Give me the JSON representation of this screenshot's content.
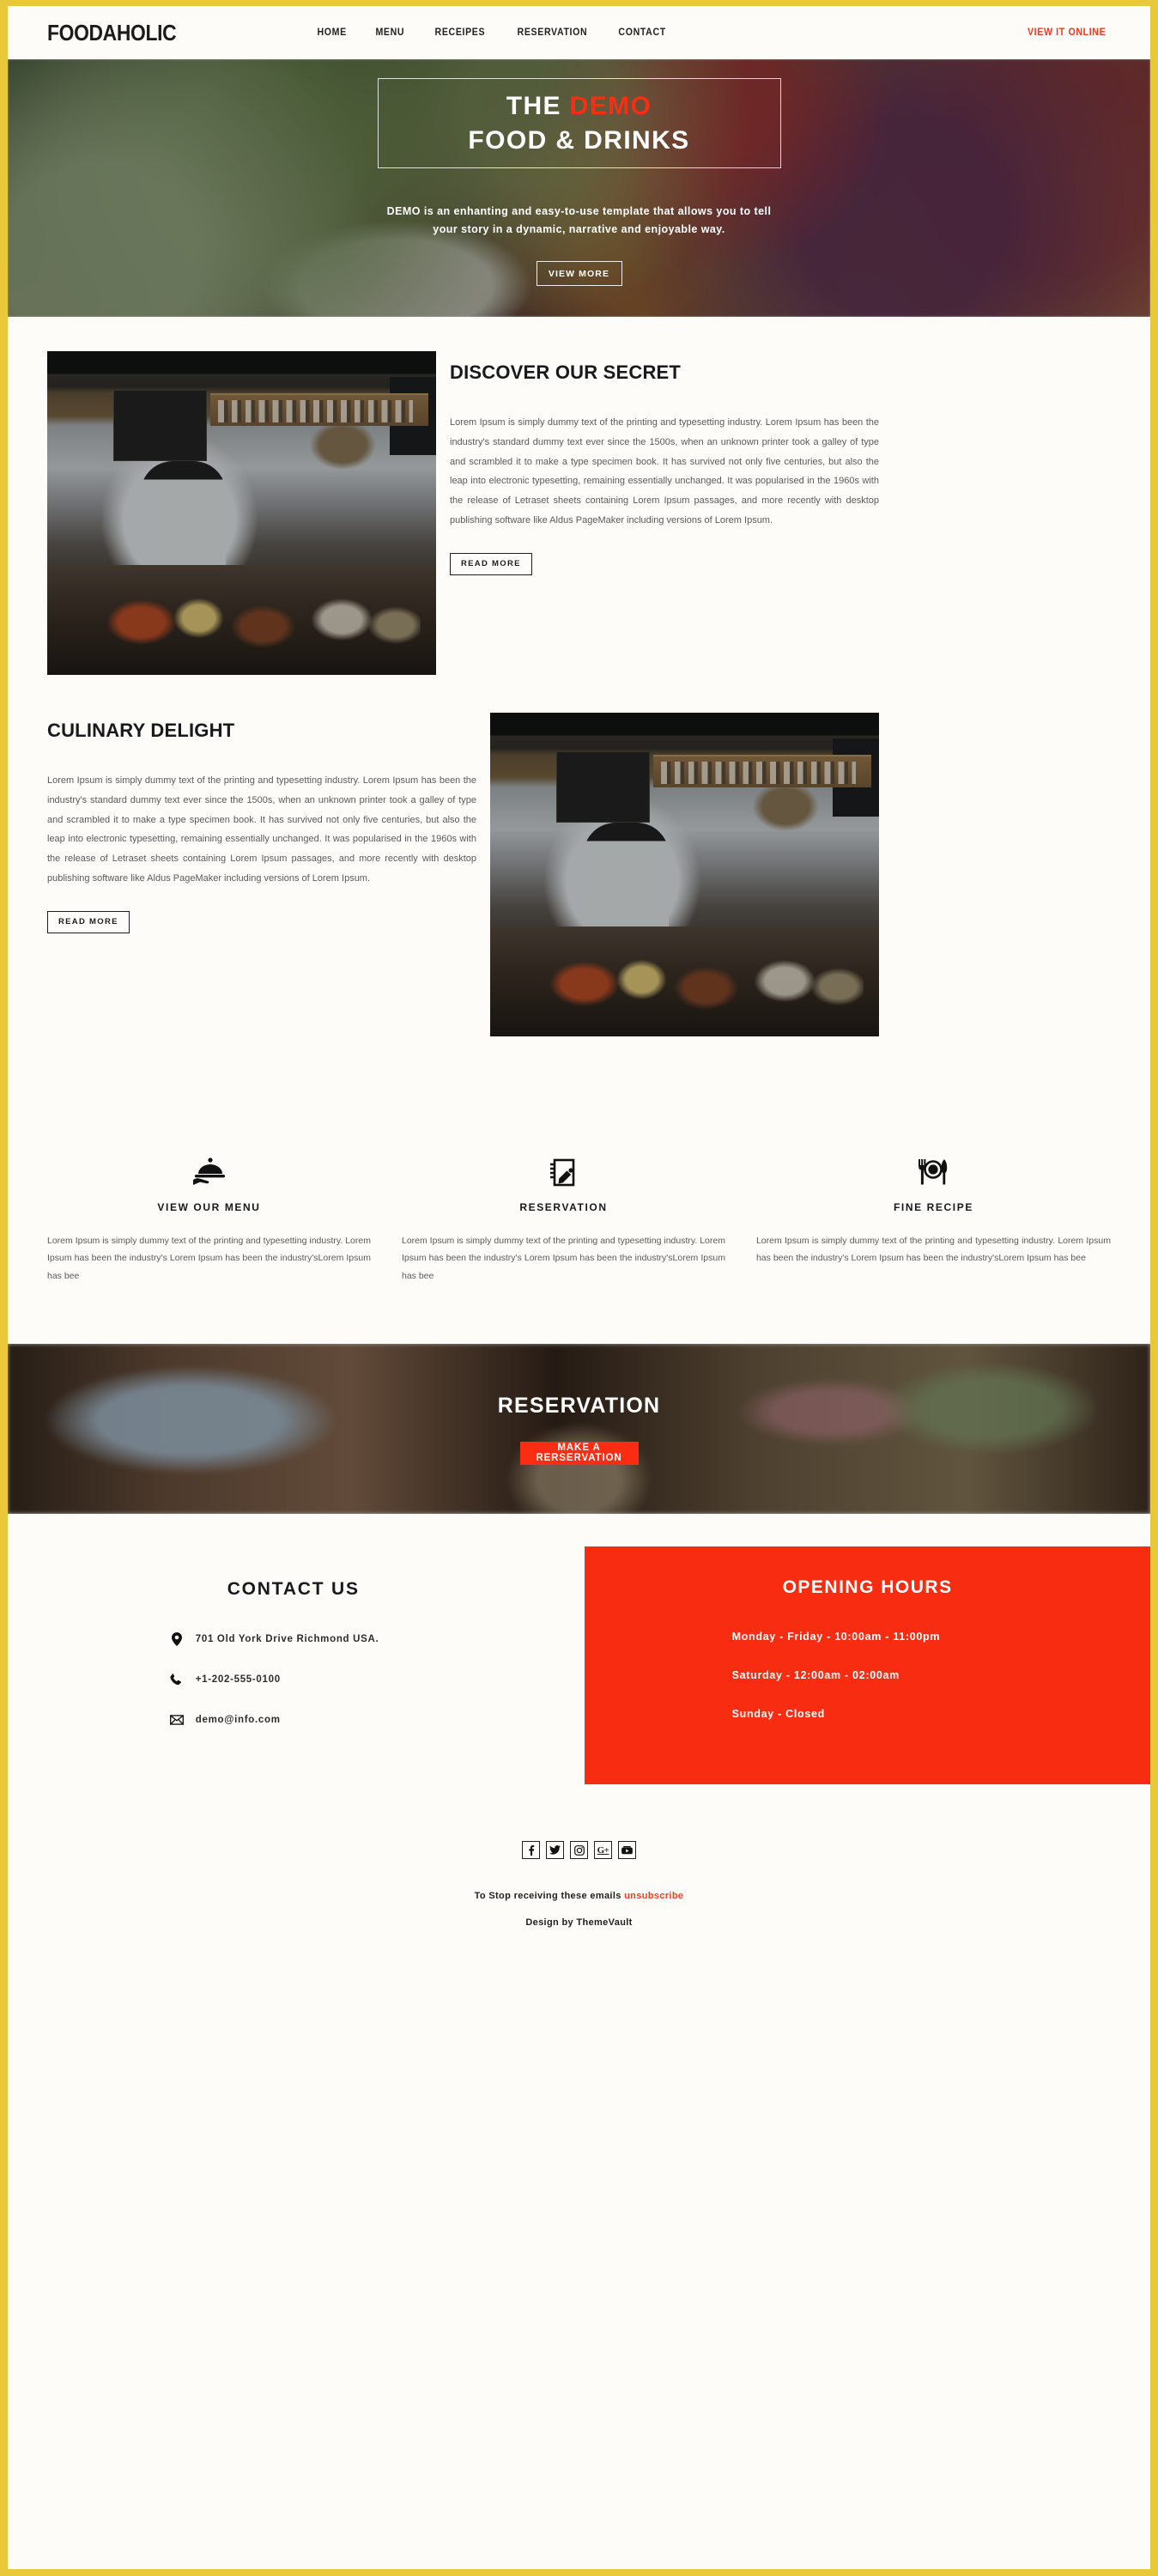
{
  "theme": {
    "frame_color": "#e9c93a",
    "accent_red": "#f72c10",
    "page_bg": "#fdfcf9",
    "text_dark": "#17191c",
    "text_body": "#5a5a5a"
  },
  "header": {
    "brand": "FOODAHOLIC",
    "nav": [
      {
        "label": "HOME"
      },
      {
        "label": "MENU"
      },
      {
        "label": "RECEIPES"
      },
      {
        "label": "RESERVATION"
      },
      {
        "label": "CONTACT"
      }
    ],
    "view_online": "VIEW IT ONLINE"
  },
  "hero": {
    "title_line1_plain": "THE ",
    "title_line1_accent": "DEMO",
    "title_line2": "FOOD & DRINKS",
    "subtitle": "DEMO is an enhanting and easy-to-use template that allows you to tell your story in a dynamic, narrative and enjoyable way.",
    "button": "VIEW MORE"
  },
  "sections": [
    {
      "title": "DISCOVER OUR SECRET",
      "body": "Lorem Ipsum is simply dummy text of the printing and typesetting industry. Lorem Ipsum has been the industry's standard dummy text ever since the 1500s, when an unknown printer took a galley of type and scrambled it to make a type specimen book. It has survived not only five centuries, but also the leap into electronic typesetting, remaining essentially unchanged. It was popularised in the 1960s with the release of Letraset sheets containing Lorem Ipsum passages, and more recently with desktop publishing software like Aldus PageMaker including versions of Lorem Ipsum.",
      "button": "READ MORE",
      "image_alt": "cafe-barista-counter-photo"
    },
    {
      "title": "CULINARY DELIGHT",
      "body": "Lorem Ipsum is simply dummy text of the printing and typesetting industry. Lorem Ipsum has been the industry's standard dummy text ever since the 1500s, when an unknown printer took a galley of type and scrambled it to make a type specimen book. It has survived not only five centuries, but also the leap into electronic typesetting, remaining essentially unchanged. It was popularised in the 1960s with the release of Letraset sheets containing Lorem Ipsum passages, and more recently with desktop publishing software like Aldus PageMaker including versions of Lorem Ipsum.",
      "button": "READ MORE",
      "image_alt": "cafe-barista-counter-photo"
    }
  ],
  "features": [
    {
      "icon": "cloche-serving-tray-icon",
      "title": "VIEW OUR MENU",
      "body": "Lorem Ipsum is simply dummy text of the printing and typesetting industry. Lorem Ipsum has been the industry's Lorem Ipsum has been the industry'sLorem Ipsum has bee"
    },
    {
      "icon": "notebook-pencil-icon",
      "title": "RESERVATION",
      "body": "Lorem Ipsum is simply dummy text of the printing and typesetting industry. Lorem Ipsum has been the industry's Lorem Ipsum has been the industry'sLorem Ipsum has bee"
    },
    {
      "icon": "fork-plate-knife-icon",
      "title": "FINE RECIPE",
      "body": "Lorem Ipsum is simply dummy text of the printing and typesetting industry. Lorem Ipsum has been the industry's Lorem Ipsum has been the industry'sLorem Ipsum has bee"
    }
  ],
  "reservation_banner": {
    "title": "RESERVATION",
    "button": "MAKE A RERSERVATION",
    "image_alt": "restaurant-table-wine-glasses-photo"
  },
  "contact": {
    "heading": "CONTACT US",
    "items": [
      {
        "icon": "map-pin-icon",
        "text": "701 Old York Drive Richmond USA."
      },
      {
        "icon": "phone-icon",
        "text": "+1-202-555-0100"
      },
      {
        "icon": "envelope-icon",
        "text": "demo@info.com"
      }
    ]
  },
  "opening_hours": {
    "heading": "OPENING HOURS",
    "items": [
      "Monday - Friday - 10:00am - 11:00pm",
      "Saturday - 12:00am - 02:00am",
      "Sunday - Closed"
    ]
  },
  "footer": {
    "socials": [
      {
        "icon": "facebook-icon",
        "glyph": "f"
      },
      {
        "icon": "twitter-icon",
        "glyph": "t"
      },
      {
        "icon": "instagram-icon",
        "glyph": "i"
      },
      {
        "icon": "google-plus-icon",
        "glyph": "G+"
      },
      {
        "icon": "youtube-icon",
        "glyph": "y"
      }
    ],
    "unsub_prefix": "To Stop receiving these emails ",
    "unsub_link": "unsubscribe",
    "credit": "Design by ThemeVault"
  }
}
